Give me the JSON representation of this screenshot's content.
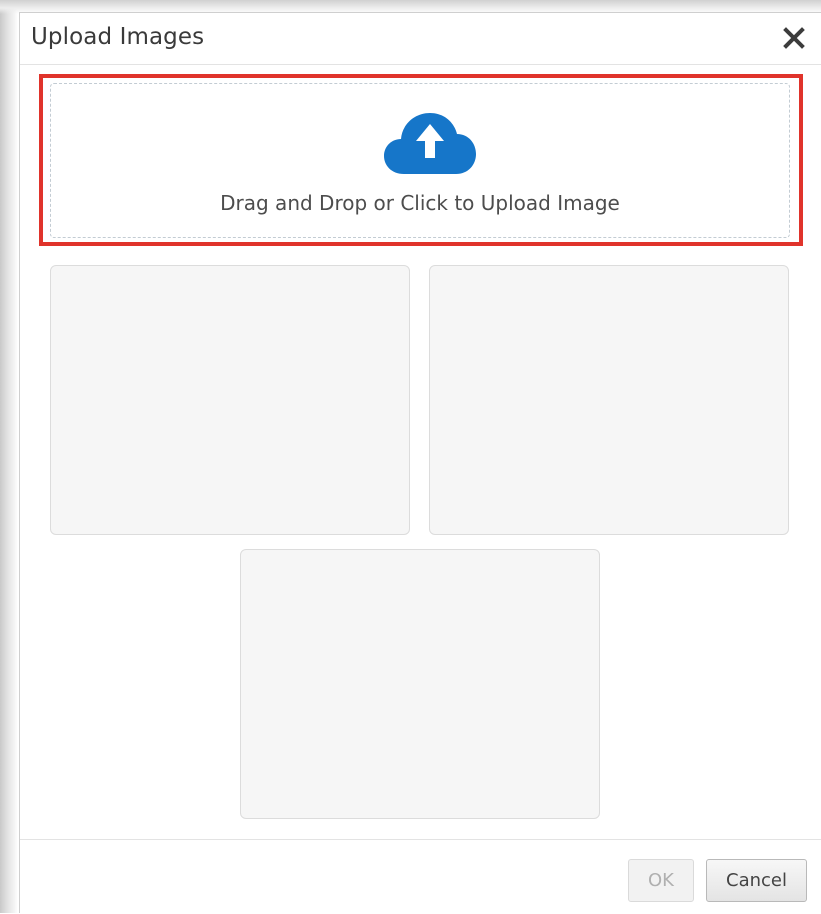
{
  "dialog": {
    "title": "Upload Images",
    "close_icon": "close-icon"
  },
  "dropzone": {
    "icon": "cloud-upload-icon",
    "label": "Drag and Drop or Click to Upload Image",
    "highlight_color": "#e0332b",
    "icon_color": "#1676c9"
  },
  "image_slots": [
    {
      "id": "slot-1"
    },
    {
      "id": "slot-2"
    },
    {
      "id": "slot-3"
    }
  ],
  "footer": {
    "ok_label": "OK",
    "ok_enabled": false,
    "cancel_label": "Cancel"
  }
}
